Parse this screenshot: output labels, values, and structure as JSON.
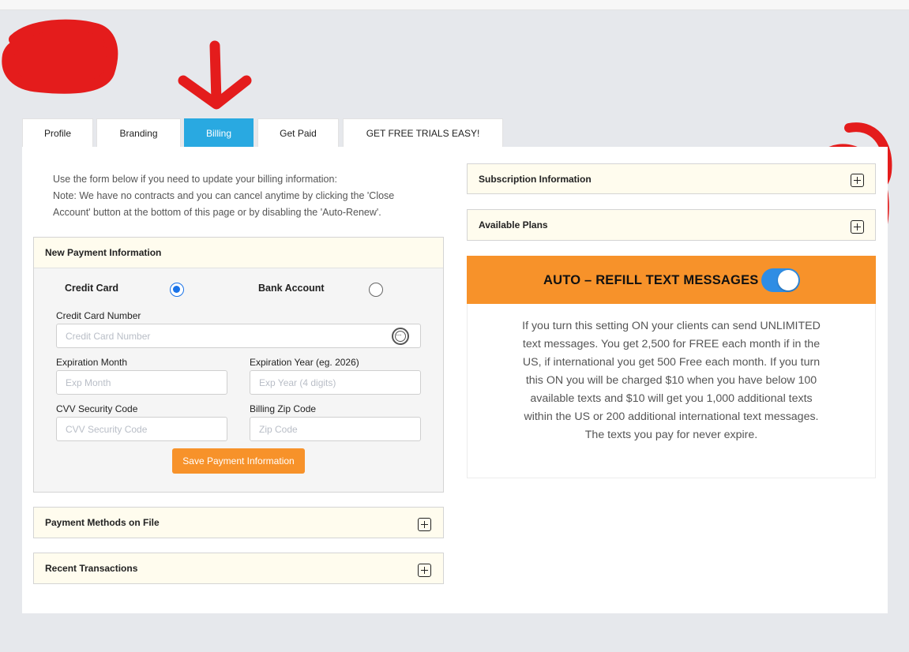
{
  "tabs": [
    {
      "label": "Profile"
    },
    {
      "label": "Branding"
    },
    {
      "label": "Billing"
    },
    {
      "label": "Get Paid"
    },
    {
      "label": "GET FREE TRIALS EASY!"
    }
  ],
  "intro": {
    "line1": "Use the form below if you need to update your billing information:",
    "line2": "Note: We have no contracts and you can cancel anytime by clicking the 'Close Account' button at the bottom of this page or by disabling the 'Auto-Renew'."
  },
  "payment_form": {
    "heading": "New Payment Information",
    "method_credit": "Credit Card",
    "method_bank": "Bank Account",
    "selected_method": "Credit Card",
    "cc_number_label": "Credit Card Number",
    "cc_number_placeholder": "Credit Card Number",
    "exp_month_label": "Expiration Month",
    "exp_month_placeholder": "Exp Month",
    "exp_year_label": "Expiration Year (eg. 2026)",
    "exp_year_placeholder": "Exp Year (4 digits)",
    "cvv_label": "CVV Security Code",
    "cvv_placeholder": "CVV Security Code",
    "zip_label": "Billing Zip Code",
    "zip_placeholder": "Zip Code",
    "save_label": "Save Payment Information"
  },
  "accordions": {
    "payment_methods": "Payment Methods on File",
    "recent_transactions": "Recent Transactions",
    "subscription": "Subscription Information",
    "available_plans": "Available Plans"
  },
  "auto_refill": {
    "title": "AUTO – REFILL TEXT MESSAGES",
    "enabled": true,
    "description": "If you turn this setting ON your clients can send UNLIMITED text messages. You get 2,500 for FREE each month if in the US, if international you get 500 Free each month. If you turn this ON you will be charged $10 when you have below 100 available texts and $10 will get you 1,000 additional texts within the US or 200 additional international text messages. The texts you pay for never expire."
  },
  "colors": {
    "active_tab": "#29a9e1",
    "accent_orange": "#f7922a",
    "toggle_on": "#2f8de4",
    "annotation_red": "#e41c1c"
  }
}
